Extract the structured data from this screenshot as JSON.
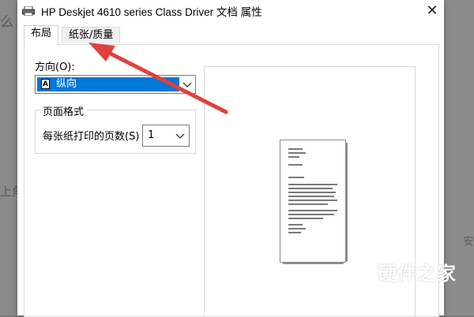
{
  "window": {
    "title": "HP Deskjet 4610 series Class Driver 文档 属性",
    "close_glyph": "✕"
  },
  "tabs": [
    {
      "label": "布局",
      "active": true
    },
    {
      "label": "纸张/质量",
      "active": false
    }
  ],
  "orientation": {
    "label": "方向(O):",
    "selected": "纵向",
    "icon_glyph": "A"
  },
  "page_format": {
    "group_title": "页面格式",
    "pages_per_sheet_label": "每张纸打印的页数(S)",
    "pages_per_sheet_value": "1"
  },
  "background_fragments": {
    "left_top": "么",
    "left_mid": "上角",
    "right_mid": "安"
  },
  "watermark": {
    "title": "硬件之家",
    "subtitle": "YING JIAN ZHI JIA.COM"
  },
  "annotation": {
    "color": "#e0413d"
  }
}
